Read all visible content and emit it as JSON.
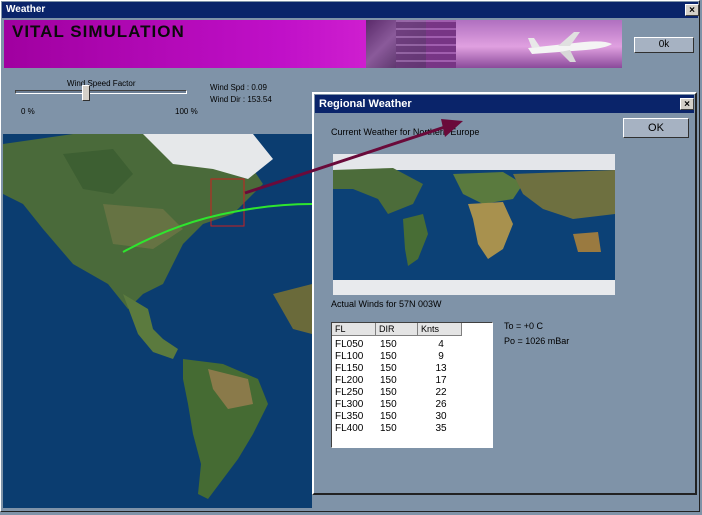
{
  "window": {
    "title": "Weather",
    "close": "×"
  },
  "banner": {
    "title": "VITAL SIMULATION"
  },
  "ok_button": "0k",
  "slider": {
    "label": "Wind Speed Factor",
    "min_label": "0 %",
    "max_label": "100 %",
    "value_fraction": 0.43
  },
  "readouts": {
    "wind_spd": "Wind Spd :  0.09",
    "wind_dir": "Wind Dir :  153.54"
  },
  "dialog": {
    "title": "Regional Weather",
    "close": "×",
    "ok": "OK",
    "current_weather": "Current Weather for Northern Europe",
    "actual_winds": "Actual Winds for 57N 003W",
    "temp": "To = +0 C",
    "pressure": "Po = 1026 mBar",
    "table": {
      "headers": [
        "FL",
        "DIR",
        "Knts"
      ],
      "rows": [
        [
          "FL050",
          "150",
          "4"
        ],
        [
          "FL100",
          "150",
          "9"
        ],
        [
          "FL150",
          "150",
          "13"
        ],
        [
          "FL200",
          "150",
          "17"
        ],
        [
          "FL250",
          "150",
          "22"
        ],
        [
          "FL300",
          "150",
          "26"
        ],
        [
          "FL350",
          "150",
          "30"
        ],
        [
          "FL400",
          "150",
          "35"
        ]
      ]
    }
  },
  "colors": {
    "titlebar": "#0a246a",
    "banner": "#c010c8",
    "route": "#2ee62e",
    "arrow": "#6a0a3a"
  }
}
